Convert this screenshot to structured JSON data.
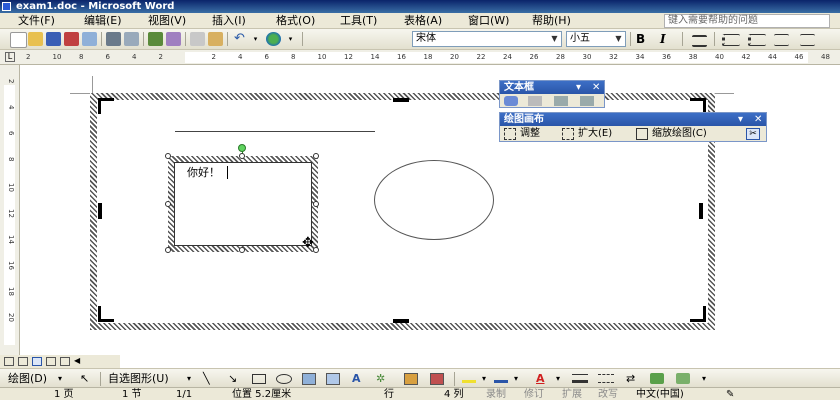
{
  "window": {
    "title": "exam1.doc - Microsoft Word"
  },
  "menu": {
    "items": [
      "文件(F)",
      "编辑(E)",
      "视图(V)",
      "插入(I)",
      "格式(O)",
      "工具(T)",
      "表格(A)",
      "窗口(W)",
      "帮助(H)"
    ],
    "help_placeholder": "键入需要帮助的问题"
  },
  "toolbar": {
    "font_name": "宋体",
    "font_size": "小五",
    "bold": "B",
    "italic": "I"
  },
  "ruler": {
    "numbers": [
      "2",
      "10",
      "8",
      "6",
      "4",
      "2",
      "",
      "2",
      "4",
      "6",
      "8",
      "10",
      "12",
      "14",
      "16",
      "18",
      "20",
      "22",
      "24",
      "26",
      "28",
      "30",
      "32",
      "34",
      "36",
      "38",
      "40",
      "42",
      "44",
      "46",
      "48"
    ],
    "vnumbers": [
      "2",
      "4",
      "6",
      "8",
      "10",
      "12",
      "14",
      "16",
      "18",
      "20"
    ]
  },
  "document": {
    "textbox_text": "你好！"
  },
  "textbox_toolbar": {
    "title": "文本框"
  },
  "canvas_toolbar": {
    "title": "绘图画布",
    "buttons": [
      "调整",
      "扩大(E)",
      "缩放绘图(C)"
    ]
  },
  "drawing_toolbar": {
    "draw_label": "绘图(D)",
    "autoshapes_label": "自选图形(U)"
  },
  "statusbar": {
    "page": "1 页",
    "section": "1 节",
    "page_of": "1/1",
    "position": "位置 5.2厘米",
    "line": "行",
    "column": "4 列",
    "rec": "录制",
    "trk": "修订",
    "ext": "扩展",
    "ovr": "改写",
    "language": "中文(中国)"
  },
  "colors": {
    "title_bar": "#0a246a",
    "chrome": "#ece9d8",
    "float_caption": "#2a55a8"
  }
}
